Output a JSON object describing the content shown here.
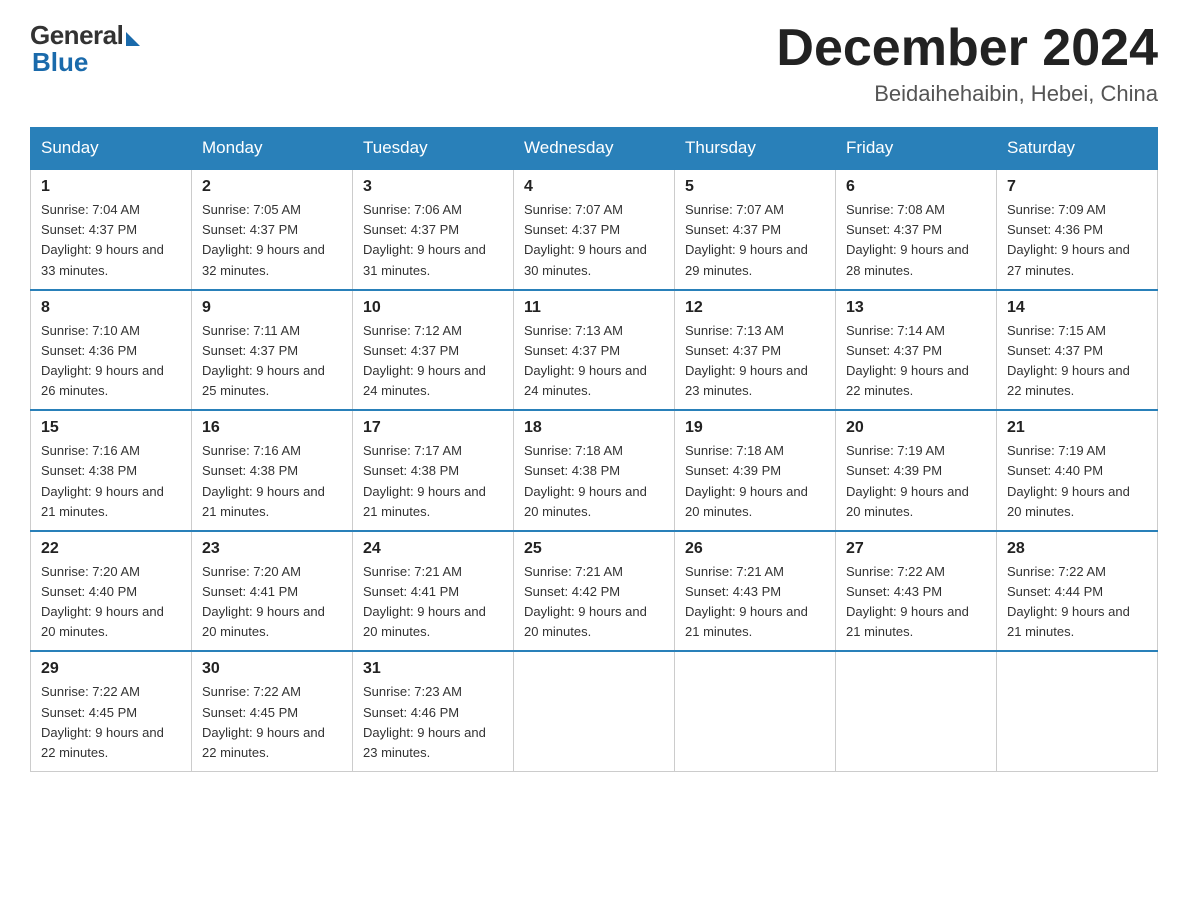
{
  "logo": {
    "general": "General",
    "blue": "Blue"
  },
  "title": {
    "month_year": "December 2024",
    "location": "Beidaihehaibin, Hebei, China"
  },
  "days_of_week": [
    "Sunday",
    "Monday",
    "Tuesday",
    "Wednesday",
    "Thursday",
    "Friday",
    "Saturday"
  ],
  "weeks": [
    [
      {
        "day": "1",
        "sunrise": "7:04 AM",
        "sunset": "4:37 PM",
        "daylight": "9 hours and 33 minutes."
      },
      {
        "day": "2",
        "sunrise": "7:05 AM",
        "sunset": "4:37 PM",
        "daylight": "9 hours and 32 minutes."
      },
      {
        "day": "3",
        "sunrise": "7:06 AM",
        "sunset": "4:37 PM",
        "daylight": "9 hours and 31 minutes."
      },
      {
        "day": "4",
        "sunrise": "7:07 AM",
        "sunset": "4:37 PM",
        "daylight": "9 hours and 30 minutes."
      },
      {
        "day": "5",
        "sunrise": "7:07 AM",
        "sunset": "4:37 PM",
        "daylight": "9 hours and 29 minutes."
      },
      {
        "day": "6",
        "sunrise": "7:08 AM",
        "sunset": "4:37 PM",
        "daylight": "9 hours and 28 minutes."
      },
      {
        "day": "7",
        "sunrise": "7:09 AM",
        "sunset": "4:36 PM",
        "daylight": "9 hours and 27 minutes."
      }
    ],
    [
      {
        "day": "8",
        "sunrise": "7:10 AM",
        "sunset": "4:36 PM",
        "daylight": "9 hours and 26 minutes."
      },
      {
        "day": "9",
        "sunrise": "7:11 AM",
        "sunset": "4:37 PM",
        "daylight": "9 hours and 25 minutes."
      },
      {
        "day": "10",
        "sunrise": "7:12 AM",
        "sunset": "4:37 PM",
        "daylight": "9 hours and 24 minutes."
      },
      {
        "day": "11",
        "sunrise": "7:13 AM",
        "sunset": "4:37 PM",
        "daylight": "9 hours and 24 minutes."
      },
      {
        "day": "12",
        "sunrise": "7:13 AM",
        "sunset": "4:37 PM",
        "daylight": "9 hours and 23 minutes."
      },
      {
        "day": "13",
        "sunrise": "7:14 AM",
        "sunset": "4:37 PM",
        "daylight": "9 hours and 22 minutes."
      },
      {
        "day": "14",
        "sunrise": "7:15 AM",
        "sunset": "4:37 PM",
        "daylight": "9 hours and 22 minutes."
      }
    ],
    [
      {
        "day": "15",
        "sunrise": "7:16 AM",
        "sunset": "4:38 PM",
        "daylight": "9 hours and 21 minutes."
      },
      {
        "day": "16",
        "sunrise": "7:16 AM",
        "sunset": "4:38 PM",
        "daylight": "9 hours and 21 minutes."
      },
      {
        "day": "17",
        "sunrise": "7:17 AM",
        "sunset": "4:38 PM",
        "daylight": "9 hours and 21 minutes."
      },
      {
        "day": "18",
        "sunrise": "7:18 AM",
        "sunset": "4:38 PM",
        "daylight": "9 hours and 20 minutes."
      },
      {
        "day": "19",
        "sunrise": "7:18 AM",
        "sunset": "4:39 PM",
        "daylight": "9 hours and 20 minutes."
      },
      {
        "day": "20",
        "sunrise": "7:19 AM",
        "sunset": "4:39 PM",
        "daylight": "9 hours and 20 minutes."
      },
      {
        "day": "21",
        "sunrise": "7:19 AM",
        "sunset": "4:40 PM",
        "daylight": "9 hours and 20 minutes."
      }
    ],
    [
      {
        "day": "22",
        "sunrise": "7:20 AM",
        "sunset": "4:40 PM",
        "daylight": "9 hours and 20 minutes."
      },
      {
        "day": "23",
        "sunrise": "7:20 AM",
        "sunset": "4:41 PM",
        "daylight": "9 hours and 20 minutes."
      },
      {
        "day": "24",
        "sunrise": "7:21 AM",
        "sunset": "4:41 PM",
        "daylight": "9 hours and 20 minutes."
      },
      {
        "day": "25",
        "sunrise": "7:21 AM",
        "sunset": "4:42 PM",
        "daylight": "9 hours and 20 minutes."
      },
      {
        "day": "26",
        "sunrise": "7:21 AM",
        "sunset": "4:43 PM",
        "daylight": "9 hours and 21 minutes."
      },
      {
        "day": "27",
        "sunrise": "7:22 AM",
        "sunset": "4:43 PM",
        "daylight": "9 hours and 21 minutes."
      },
      {
        "day": "28",
        "sunrise": "7:22 AM",
        "sunset": "4:44 PM",
        "daylight": "9 hours and 21 minutes."
      }
    ],
    [
      {
        "day": "29",
        "sunrise": "7:22 AM",
        "sunset": "4:45 PM",
        "daylight": "9 hours and 22 minutes."
      },
      {
        "day": "30",
        "sunrise": "7:22 AM",
        "sunset": "4:45 PM",
        "daylight": "9 hours and 22 minutes."
      },
      {
        "day": "31",
        "sunrise": "7:23 AM",
        "sunset": "4:46 PM",
        "daylight": "9 hours and 23 minutes."
      },
      null,
      null,
      null,
      null
    ]
  ]
}
